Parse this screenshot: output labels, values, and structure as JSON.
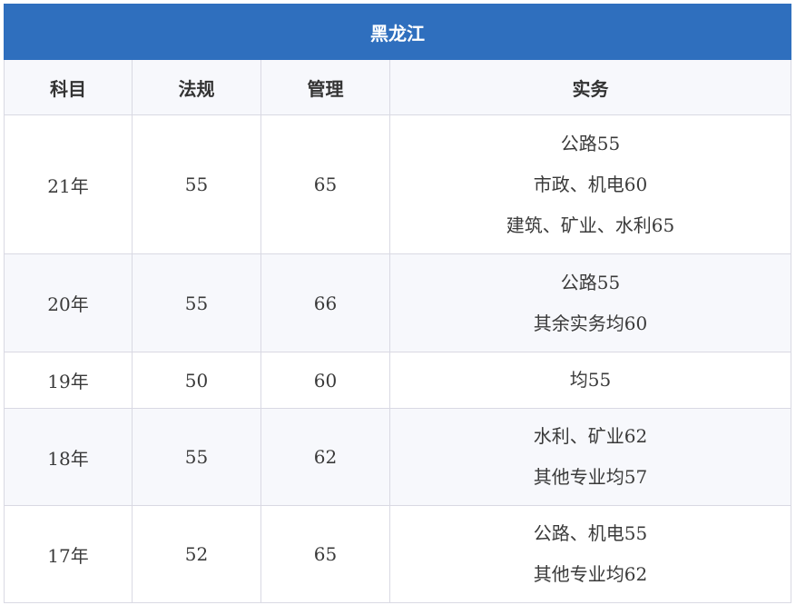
{
  "table": {
    "title": "黑龙江",
    "headers": [
      "科目",
      "法规",
      "管理",
      "实务"
    ],
    "rows": [
      {
        "year": "21年",
        "law": "55",
        "management": "65",
        "practice": [
          "公路55",
          "市政、机电60",
          "建筑、矿业、水利65"
        ]
      },
      {
        "year": "20年",
        "law": "55",
        "management": "66",
        "practice": [
          "公路55",
          "其余实务均60"
        ]
      },
      {
        "year": "19年",
        "law": "50",
        "management": "60",
        "practice": [
          "均55"
        ]
      },
      {
        "year": "18年",
        "law": "55",
        "management": "62",
        "practice": [
          "水利、矿业62",
          "其他专业均57"
        ]
      },
      {
        "year": "17年",
        "law": "52",
        "management": "65",
        "practice": [
          "公路、机电55",
          "其他专业均62"
        ]
      }
    ]
  },
  "colors": {
    "title_bg": "#2f6fbe",
    "border": "#d9d9e3",
    "stripe": "#f7f8fc"
  }
}
